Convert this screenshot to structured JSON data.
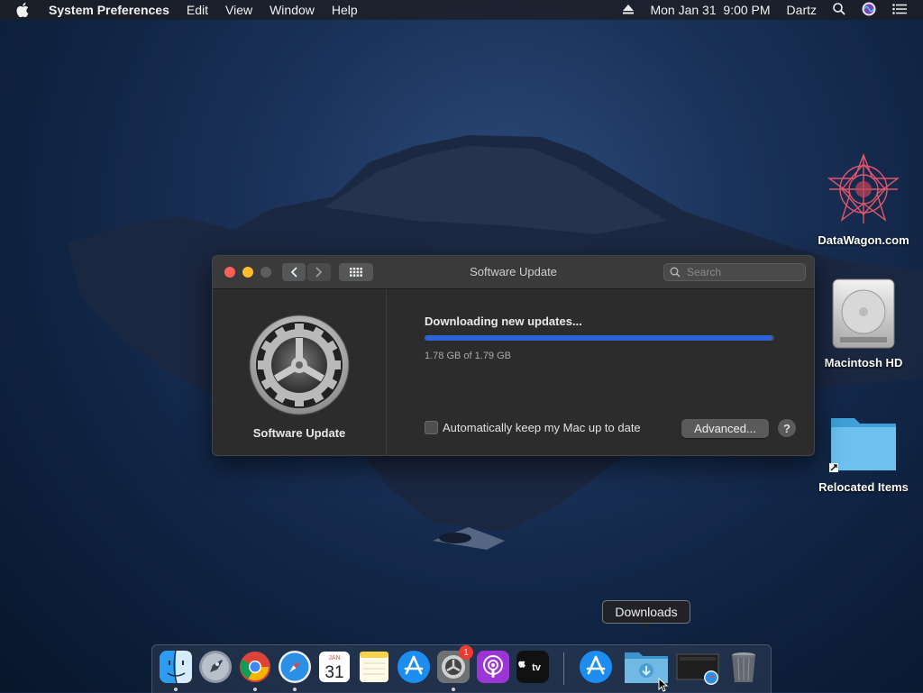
{
  "menubar": {
    "app_name": "System Preferences",
    "menus": [
      "Edit",
      "View",
      "Window",
      "Help"
    ],
    "clock": "Mon Jan 31  9:00 PM",
    "user": "Dartz"
  },
  "desktop": {
    "icons": [
      {
        "label": "DataWagon.com"
      },
      {
        "label": "Macintosh HD"
      },
      {
        "label": "Relocated Items"
      }
    ]
  },
  "window": {
    "title": "Software Update",
    "search_placeholder": "Search",
    "pane_label": "Software Update",
    "status_text": "Downloading new updates...",
    "progress_fraction": 0.995,
    "progress_text": "1.78 GB of 1.79 GB",
    "auto_update_label": "Automatically keep my Mac up to date",
    "auto_update_checked": false,
    "advanced_label": "Advanced...",
    "help_label": "?"
  },
  "tooltip": "Downloads",
  "dock": {
    "calendar_month": "JAN",
    "calendar_day": "31",
    "appletv_label": "tv",
    "preferences_badge": "1"
  },
  "colors": {
    "accent": "#2b64d6",
    "close": "#ff5f57",
    "minimize": "#febc2e"
  }
}
